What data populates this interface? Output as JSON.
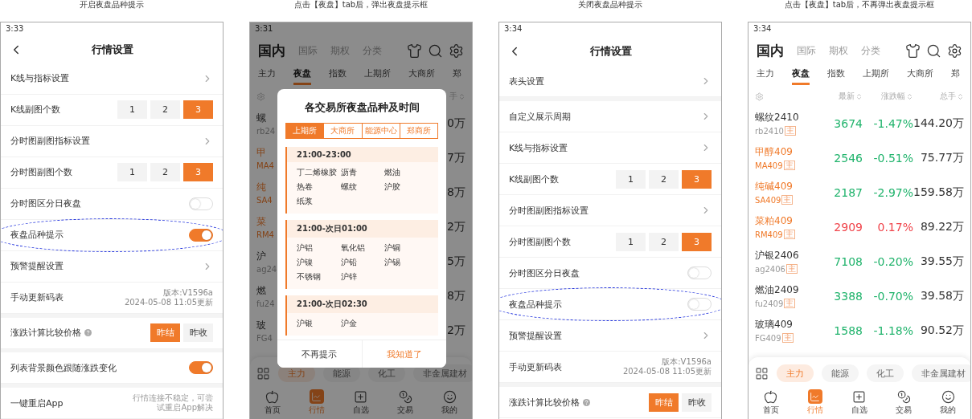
{
  "panels": [
    {
      "kind": "settings",
      "caption": "开启夜盘品种提示",
      "status_time": "3:33",
      "title": "行情设置",
      "rows": [
        {
          "kind": "link",
          "label": "K线与指标设置"
        },
        {
          "kind": "segment",
          "label": "K线副图个数",
          "options": [
            {
              "label": "1",
              "selected": false
            },
            {
              "label": "2",
              "selected": false
            },
            {
              "label": "3",
              "selected": true
            }
          ]
        },
        {
          "kind": "link",
          "label": "分时图副图指标设置"
        },
        {
          "kind": "segment",
          "label": "分时图副图个数",
          "options": [
            {
              "label": "1",
              "selected": false
            },
            {
              "label": "2",
              "selected": false
            },
            {
              "label": "3",
              "selected": true
            }
          ]
        },
        {
          "kind": "toggle",
          "label": "分时图区分日夜盘",
          "on": false,
          "highlighted": false
        },
        {
          "kind": "toggle",
          "label": "夜盘品种提示",
          "on": true,
          "highlighted": true
        },
        {
          "kind": "link",
          "label": "预警提醒设置"
        },
        {
          "kind": "version",
          "label": "手动更新码表",
          "lines": [
            "版本:V1596a",
            "2024-05-08 11:05更新"
          ]
        },
        {
          "kind": "segment",
          "label": "涨跌计算比较价格",
          "help": true,
          "section_break": true,
          "options": [
            {
              "label": "昨结",
              "selected": true
            },
            {
              "label": "昨收",
              "selected": false
            }
          ]
        },
        {
          "kind": "toggle",
          "label": "列表背景颜色跟随涨跌变化",
          "on": true,
          "highlighted": false,
          "section_break": true
        },
        {
          "kind": "info",
          "label": "一键重启App",
          "note": "行情连接不稳定，可尝试重启App解决",
          "section_break": true
        }
      ]
    },
    {
      "kind": "market",
      "caption": "点击【夜盘】tab后，弹出夜盘提示框",
      "status_time": "3:31",
      "top_tabs": [
        {
          "label": "国内",
          "selected": true
        },
        {
          "label": "国际",
          "selected": false
        },
        {
          "label": "期权",
          "selected": false
        },
        {
          "label": "分类",
          "selected": false
        }
      ],
      "sub_tabs": [
        {
          "label": "主力",
          "selected": false
        },
        {
          "label": "夜盘",
          "selected": true
        },
        {
          "label": "指数",
          "selected": false
        },
        {
          "label": "上期所",
          "selected": false
        },
        {
          "label": "大商所",
          "selected": false
        },
        {
          "label": "郑",
          "selected": false
        }
      ],
      "columns": [
        "手"
      ],
      "rows": [
        {
          "name": "螺",
          "code": "rb24",
          "total": "0万",
          "highlighted": false
        },
        {
          "name": "甲",
          "code": "MA4",
          "total": "7万",
          "highlighted": true
        },
        {
          "name": "纯",
          "code": "SA4",
          "total": "8万",
          "highlighted": true
        },
        {
          "name": "菜",
          "code": "RM4",
          "total": "2万",
          "highlighted": true
        },
        {
          "name": "沪",
          "code": "ag24",
          "total": "5万",
          "highlighted": false
        },
        {
          "name": "燃",
          "code": "fu24",
          "total": "8万",
          "highlighted": false
        },
        {
          "name": "玻",
          "code": "FG4",
          "total": "2万",
          "highlighted": false
        }
      ],
      "categories": [
        {
          "label": "主力",
          "selected": true
        },
        {
          "label": "能源",
          "selected": false
        },
        {
          "label": "化工",
          "selected": false
        },
        {
          "label": "非金属建材",
          "selected": false
        }
      ],
      "nav": [
        {
          "label": "首页",
          "selected": false
        },
        {
          "label": "行情",
          "selected": true
        },
        {
          "label": "自选",
          "selected": false
        },
        {
          "label": "交易",
          "selected": false
        },
        {
          "label": "我的",
          "selected": false
        }
      ],
      "modal": {
        "title": "各交易所夜盘品种及时间",
        "exchanges": [
          {
            "label": "上期所",
            "selected": true
          },
          {
            "label": "大商所",
            "selected": false
          },
          {
            "label": "能源中心",
            "selected": false
          },
          {
            "label": "郑商所",
            "selected": false
          }
        ],
        "sessions": [
          {
            "time": "21:00-23:00",
            "items": [
              "丁二烯橡胶",
              "沥青",
              "燃油",
              "热卷",
              "螺纹",
              "沪胶",
              "纸浆"
            ]
          },
          {
            "time": "21:00-次日01:00",
            "items": [
              "沪铝",
              "氧化铝",
              "沪铜",
              "沪镍",
              "沪铅",
              "沪锡",
              "不锈钢",
              "沪锌"
            ]
          },
          {
            "time": "21:00-次日02:30",
            "items": [
              "沪银",
              "沪金"
            ]
          }
        ],
        "buttons": [
          {
            "label": "不再提示",
            "kind": "secondary"
          },
          {
            "label": "我知道了",
            "kind": "primary"
          }
        ]
      }
    },
    {
      "kind": "settings",
      "caption": "关闭夜盘品种提示",
      "status_time": "3:34",
      "title": "行情设置",
      "rows": [
        {
          "kind": "link",
          "label": "表头设置"
        },
        {
          "kind": "link",
          "label": "自定义展示周期",
          "section_break": true
        },
        {
          "kind": "link",
          "label": "K线与指标设置"
        },
        {
          "kind": "segment",
          "label": "K线副图个数",
          "options": [
            {
              "label": "1",
              "selected": false
            },
            {
              "label": "2",
              "selected": false
            },
            {
              "label": "3",
              "selected": true
            }
          ]
        },
        {
          "kind": "link",
          "label": "分时图副图指标设置"
        },
        {
          "kind": "segment",
          "label": "分时图副图个数",
          "options": [
            {
              "label": "1",
              "selected": false
            },
            {
              "label": "2",
              "selected": false
            },
            {
              "label": "3",
              "selected": true
            }
          ]
        },
        {
          "kind": "toggle",
          "label": "分时图区分日夜盘",
          "on": false,
          "highlighted": false
        },
        {
          "kind": "toggle",
          "label": "夜盘品种提示",
          "on": false,
          "highlighted": true
        },
        {
          "kind": "link",
          "label": "预警提醒设置"
        },
        {
          "kind": "version",
          "label": "手动更新码表",
          "lines": [
            "版本:V1596a",
            "2024-05-08 11:05更新"
          ]
        },
        {
          "kind": "segment",
          "label": "涨跌计算比较价格",
          "help": true,
          "section_break": true,
          "options": [
            {
              "label": "昨结",
              "selected": true
            },
            {
              "label": "昨收",
              "selected": false
            }
          ]
        }
      ]
    },
    {
      "kind": "market",
      "caption": "点击【夜盘】tab后，不再弹出夜盘提示框",
      "status_time": "3:34",
      "top_tabs": [
        {
          "label": "国内",
          "selected": true
        },
        {
          "label": "国际",
          "selected": false
        },
        {
          "label": "期权",
          "selected": false
        },
        {
          "label": "分类",
          "selected": false
        }
      ],
      "sub_tabs": [
        {
          "label": "主力",
          "selected": false
        },
        {
          "label": "夜盘",
          "selected": true
        },
        {
          "label": "指数",
          "selected": false
        },
        {
          "label": "上期所",
          "selected": false
        },
        {
          "label": "大商所",
          "selected": false
        },
        {
          "label": "郑",
          "selected": false
        }
      ],
      "columns": [
        "最新",
        "涨跌幅",
        "总手"
      ],
      "rows": [
        {
          "name": "螺纹2410",
          "code": "rb2410",
          "badge": "主",
          "price": "3674",
          "change": "-1.47%",
          "total": "144.20万",
          "color": "#1fb36b",
          "highlighted": false
        },
        {
          "name": "甲醇409",
          "code": "MA409",
          "badge": "主",
          "price": "2546",
          "change": "-0.51%",
          "total": "75.77万",
          "color": "#1fb36b",
          "highlighted": true
        },
        {
          "name": "纯碱409",
          "code": "SA409",
          "badge": "主",
          "price": "2187",
          "change": "-2.97%",
          "total": "159.58万",
          "color": "#1fb36b",
          "highlighted": true
        },
        {
          "name": "菜粕409",
          "code": "RM409",
          "badge": "主",
          "price": "2909",
          "change": "0.17%",
          "total": "89.22万",
          "color": "#f0434a",
          "highlighted": true
        },
        {
          "name": "沪银2406",
          "code": "ag2406",
          "badge": "主",
          "price": "7108",
          "change": "-0.20%",
          "total": "39.55万",
          "color": "#1fb36b",
          "highlighted": false
        },
        {
          "name": "燃油2409",
          "code": "fu2409",
          "badge": "主",
          "price": "3388",
          "change": "-0.70%",
          "total": "39.58万",
          "color": "#1fb36b",
          "highlighted": false
        },
        {
          "name": "玻璃409",
          "code": "FG409",
          "badge": "主",
          "price": "1588",
          "change": "-1.18%",
          "total": "90.52万",
          "color": "#1fb36b",
          "highlighted": false
        }
      ],
      "categories": [
        {
          "label": "主力",
          "selected": true
        },
        {
          "label": "能源",
          "selected": false
        },
        {
          "label": "化工",
          "selected": false
        },
        {
          "label": "非金属建材",
          "selected": false
        }
      ],
      "nav": [
        {
          "label": "首页",
          "selected": false
        },
        {
          "label": "行情",
          "selected": true
        },
        {
          "label": "自选",
          "selected": false
        },
        {
          "label": "交易",
          "selected": false
        },
        {
          "label": "我的",
          "selected": false
        }
      ]
    }
  ]
}
